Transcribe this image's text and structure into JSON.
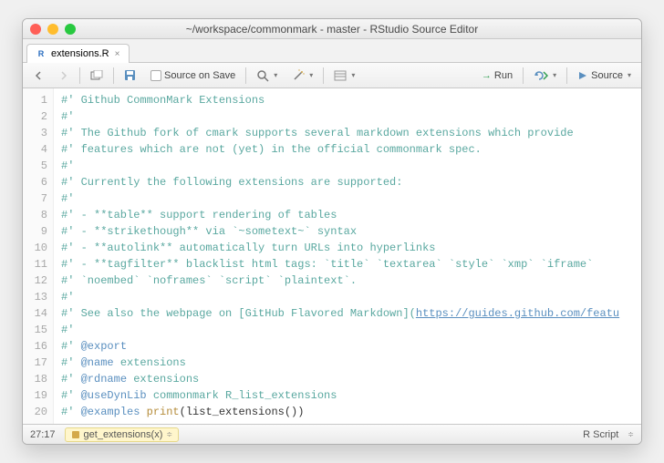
{
  "window": {
    "title": "~/workspace/commonmark - master - RStudio Source Editor"
  },
  "tab": {
    "filename": "extensions.R"
  },
  "toolbar": {
    "source_on_save": "Source on Save",
    "run": "Run",
    "source": "Source"
  },
  "code": {
    "lines": [
      {
        "n": 1,
        "t": "roxygen",
        "text": "#' Github CommonMark Extensions"
      },
      {
        "n": 2,
        "t": "roxygen",
        "text": "#'"
      },
      {
        "n": 3,
        "t": "roxygen",
        "text": "#' The Github fork of cmark supports several markdown extensions which provide"
      },
      {
        "n": 4,
        "t": "roxygen",
        "text": "#' features which are not (yet) in the official commonmark spec."
      },
      {
        "n": 5,
        "t": "roxygen",
        "text": "#'"
      },
      {
        "n": 6,
        "t": "roxygen",
        "text": "#' Currently the following extensions are supported:"
      },
      {
        "n": 7,
        "t": "roxygen",
        "text": "#'"
      },
      {
        "n": 8,
        "t": "roxygen",
        "text": "#'  - **table** support rendering of tables"
      },
      {
        "n": 9,
        "t": "roxygen",
        "text": "#'  - **strikethough** via `~sometext~` syntax"
      },
      {
        "n": 10,
        "t": "roxygen",
        "text": "#'  - **autolink** automatically turn URLs into hyperlinks"
      },
      {
        "n": 11,
        "t": "roxygen",
        "text": "#'  - **tagfilter** blacklist html tags: `title` `textarea` `style` `xmp` `iframe`"
      },
      {
        "n": 12,
        "t": "roxygen",
        "text": "#' `noembed` `noframes` `script` `plaintext`."
      },
      {
        "n": 13,
        "t": "roxygen",
        "text": "#'"
      },
      {
        "n": 14,
        "t": "roxygen-link",
        "pre": "#' See also the webpage on [GitHub Flavored Markdown](",
        "link": "https://guides.github.com/featu"
      },
      {
        "n": 15,
        "t": "roxygen",
        "text": "#'"
      },
      {
        "n": 16,
        "t": "tag",
        "pre": "#' ",
        "tag": "@export",
        "post": ""
      },
      {
        "n": 17,
        "t": "tag",
        "pre": "#' ",
        "tag": "@name",
        "post": " extensions"
      },
      {
        "n": 18,
        "t": "tag",
        "pre": "#' ",
        "tag": "@rdname",
        "post": " extensions"
      },
      {
        "n": 19,
        "t": "tag",
        "pre": "#' ",
        "tag": "@useDynLib",
        "post": " commonmark R_list_extensions"
      },
      {
        "n": 20,
        "t": "tag-fn",
        "pre": "#' ",
        "tag": "@examples",
        "mid": " ",
        "fn": "print",
        "post": "(list_extensions())"
      }
    ]
  },
  "status": {
    "cursor": "27:17",
    "fn": "get_extensions(x)",
    "lang": "R Script"
  }
}
